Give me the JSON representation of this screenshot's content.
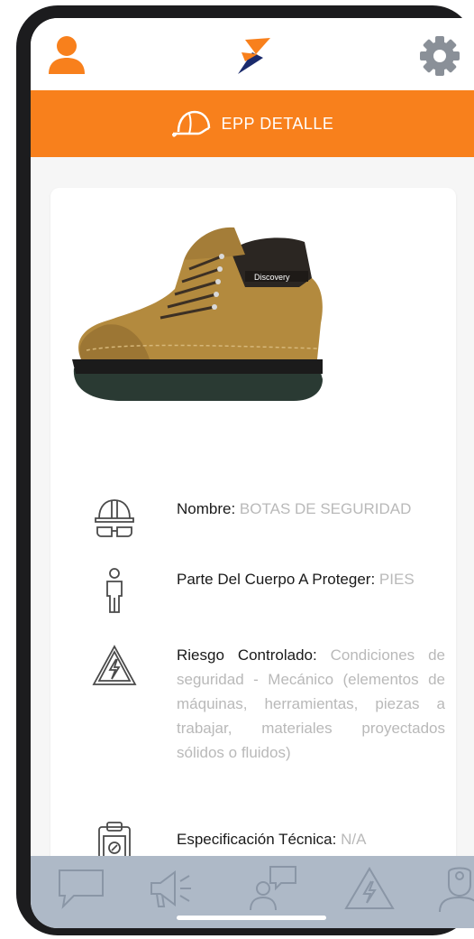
{
  "header": {
    "user_icon": "user-icon",
    "logo": "brand-logo",
    "settings_icon": "gear-icon"
  },
  "title_bar": {
    "icon": "helmet-icon",
    "title": "EPP DETALLE"
  },
  "product": {
    "image": "safety-boot-image",
    "brand_text": "Discovery"
  },
  "details": [
    {
      "icon": "helmet-goggles-icon",
      "label": "Nombre:",
      "value": "BOTAS DE SEGURIDAD"
    },
    {
      "icon": "body-icon",
      "label": "Parte Del Cuerpo A Proteger:",
      "value": "PIES"
    },
    {
      "icon": "hazard-warning-icon",
      "label": "Riesgo Controlado:",
      "value": "Condiciones de seguridad - Mecánico (elementos de máquinas, herramientas, piezas a trabajar, materiales proyectados sólidos o fluidos)"
    },
    {
      "icon": "clipboard-icon",
      "label": "Especificación Técnica:",
      "value": "N/A"
    }
  ],
  "bottom_nav": [
    "chat-icon",
    "megaphone-icon",
    "person-message-icon",
    "hazard-icon",
    "doctor-icon"
  ],
  "colors": {
    "accent": "#f8801c",
    "bottom_bar": "#aeb9c7",
    "label_text": "#1a1a1a",
    "value_text": "#b9b9b9"
  }
}
